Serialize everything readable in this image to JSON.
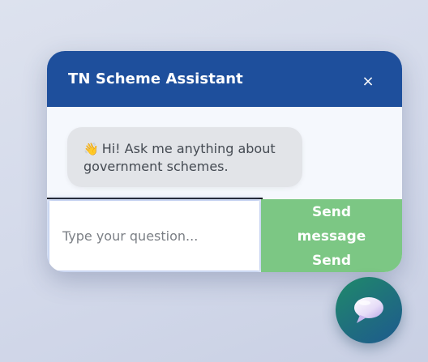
{
  "chat": {
    "title": "TN Scheme Assistant",
    "close_label": "×",
    "messages": [
      {
        "sender": "bot",
        "emoji": "👋",
        "text": "Hi! Ask me anything about government schemes."
      }
    ],
    "input": {
      "placeholder": "Type your question...",
      "value": ""
    },
    "send": {
      "line1": "Send",
      "line2": "message",
      "line3": "Send"
    }
  },
  "fab": {
    "icon": "speech-bubble-icon"
  },
  "colors": {
    "header": "#1e4f9c",
    "send_button": "#7cc784",
    "bubble": "#e2e4e8",
    "fab_gradient_start": "#1f8a6a",
    "fab_gradient_end": "#1e5a8e"
  }
}
